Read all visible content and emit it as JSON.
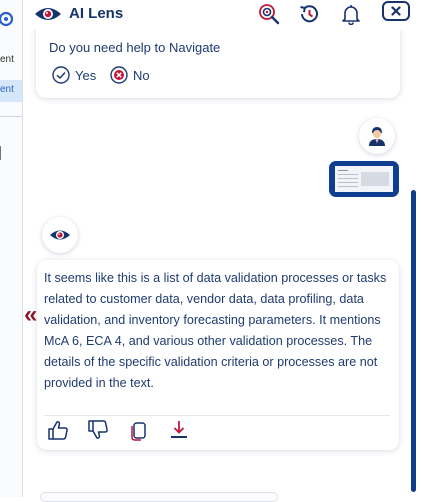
{
  "app": {
    "title": "AI Lens",
    "colors": {
      "brand": "#17336b",
      "accent_red": "#c0163a",
      "thumb_bg": "#0f3d8f"
    },
    "header_icons": [
      "lens-search-icon",
      "history-icon",
      "bell-icon",
      "close-icon"
    ]
  },
  "left_strip": {
    "text_top": "ent",
    "text_tab": "ent"
  },
  "conversation": {
    "prompt_card": {
      "question": "Do you need help to Navigate",
      "yes_label": "Yes",
      "no_label": "No"
    },
    "response": {
      "text": "It seems like this is a list of data validation processes or tasks related to customer data, vendor data, data profiling, data validation, and inventory forecasting parameters. It mentions McA 6, ECA 4, and various other validation processes. The details of the specific validation criteria or processes are not provided in the text.",
      "actions": [
        "thumbs-up-icon",
        "thumbs-down-icon",
        "copy-icon",
        "download-icon"
      ]
    },
    "collapse_glyph": "«"
  }
}
